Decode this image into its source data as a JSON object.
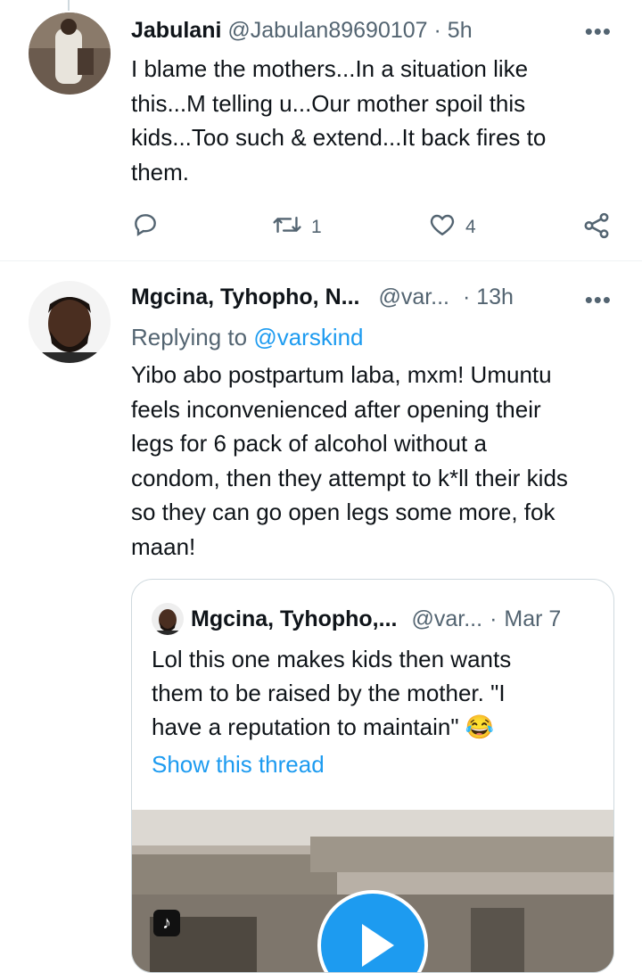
{
  "tweet1": {
    "name": "Jabulani",
    "handle": "@Jabulan89690107",
    "sep": "·",
    "time": "5h",
    "more": "•••",
    "lines": [
      "I blame the mothers...In a situation like",
      "this...M telling u...Our mother spoil this",
      "kids...Too such & extend...It back fires to",
      "them."
    ],
    "retweets": "1",
    "likes": "4",
    "icons": [
      "reply-icon",
      "retweet-icon",
      "like-icon",
      "share-icon"
    ]
  },
  "tweet2": {
    "name": "Mgcina, Tyhopho, N...",
    "handle": "@var...",
    "sep": "·",
    "time": "13h",
    "more": "•••",
    "replying_prefix": "Replying to ",
    "replying_to": "@varskind",
    "lines": [
      "Yibo abo postpartum laba, mxm! Umuntu",
      "feels inconvenienced after opening their",
      "legs for 6 pack of alcohol without a",
      "condom, then they attempt to k*ll their kids",
      "so they can go open legs some more, fok",
      "maan!"
    ]
  },
  "quote": {
    "name": "Mgcina, Tyhopho,...",
    "handle": "@var...",
    "sep": "·",
    "date": "Mar 7",
    "lines": [
      "Lol this one makes kids then wants",
      "them to be raised by the mother. \"I",
      "have a reputation to maintain\" 😂"
    ],
    "show_thread": "Show this thread"
  },
  "colors": {
    "link": "#1d9bf0",
    "muted": "#536471",
    "border": "#cfd9de"
  }
}
